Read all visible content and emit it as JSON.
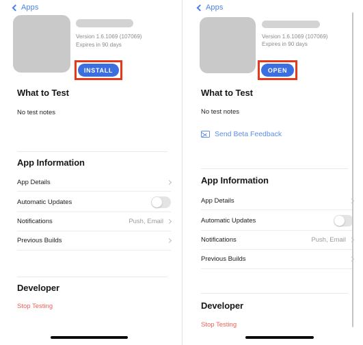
{
  "panels": [
    {
      "id": "before-install",
      "nav": {
        "back_icon": "chevron-left-icon",
        "back_label": "Apps"
      },
      "app": {
        "icon": "app-icon-placeholder",
        "name_redacted": true,
        "version": "Version 1.6.1069 (107069)",
        "expires": "Expires in 90 days",
        "action_label": "INSTALL",
        "action_annotated": true
      },
      "what_to_test": {
        "title": "What to Test",
        "notes": "No test notes",
        "feedback_link": null,
        "feedback_icon": null
      },
      "app_information": {
        "title": "App Information",
        "rows": [
          {
            "label": "App Details",
            "value": "",
            "control": "disclosure"
          },
          {
            "label": "Automatic Updates",
            "value": "",
            "control": "toggle",
            "toggle_on": false
          },
          {
            "label": "Notifications",
            "value": "Push, Email",
            "control": "disclosure"
          },
          {
            "label": "Previous Builds",
            "value": "",
            "control": "disclosure"
          }
        ]
      },
      "developer": {
        "title": "Developer",
        "action_label": "Stop Testing"
      },
      "home_indicator": true,
      "scrollbar": false
    },
    {
      "id": "after-install",
      "nav": {
        "back_icon": "chevron-left-icon",
        "back_label": "Apps"
      },
      "app": {
        "icon": "app-icon-placeholder",
        "name_redacted": true,
        "version": "Version 1.6.1069 (107069)",
        "expires": "Expires in 90 days",
        "action_label": "OPEN",
        "action_annotated": true
      },
      "what_to_test": {
        "title": "What to Test",
        "notes": "No test notes",
        "feedback_link": "Send Beta Feedback",
        "feedback_icon": "envelope-icon"
      },
      "app_information": {
        "title": "App Information",
        "rows": [
          {
            "label": "App Details",
            "value": "",
            "control": "disclosure"
          },
          {
            "label": "Automatic Updates",
            "value": "",
            "control": "toggle",
            "toggle_on": false
          },
          {
            "label": "Notifications",
            "value": "Push, Email",
            "control": "disclosure"
          },
          {
            "label": "Previous Builds",
            "value": "",
            "control": "disclosure"
          }
        ]
      },
      "developer": {
        "title": "Developer",
        "action_label": "Stop Testing"
      },
      "home_indicator": true,
      "scrollbar": true
    }
  ],
  "colors": {
    "accent_blue": "#3b6fe0",
    "link_blue": "#5b8def",
    "nav_blue": "#4a82e8",
    "annotation_red": "#e8381c",
    "danger_red": "#f0615a",
    "placeholder_gray": "#c9c9c9"
  }
}
